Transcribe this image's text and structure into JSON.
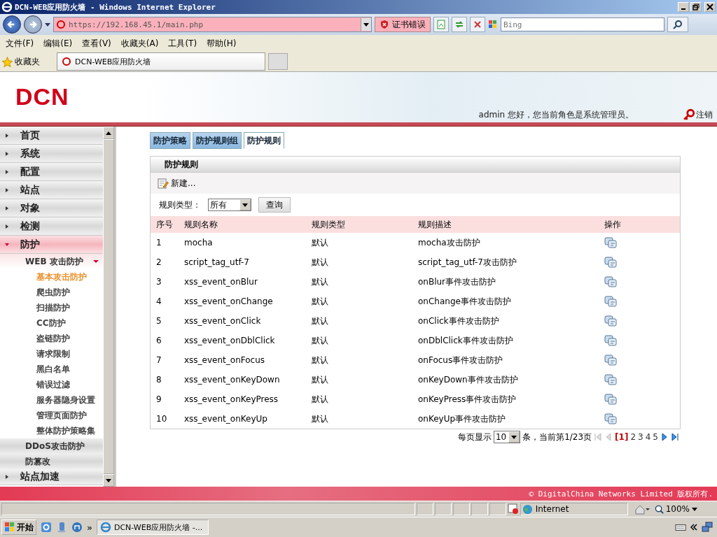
{
  "browser": {
    "title": "DCN-WEB应用防火墙 - Windows Internet Explorer",
    "address": "https://192.168.45.1/main.php",
    "cert_error": "证书错误",
    "search_placeholder": "Bing",
    "menus": [
      "文件(F)",
      "编辑(E)",
      "查看(V)",
      "收藏夹(A)",
      "工具(T)",
      "帮助(H)"
    ],
    "favorites": "收藏夹",
    "tab": "DCN-WEB应用防火墙"
  },
  "header": {
    "logo": "DCN",
    "greeting": "admin 您好，您当前角色是系统管理员。",
    "logout": "注销"
  },
  "sidebar": {
    "items": [
      {
        "label": "首页",
        "expanded": false
      },
      {
        "label": "系统",
        "expanded": false
      },
      {
        "label": "配置",
        "expanded": false
      },
      {
        "label": "站点",
        "expanded": false
      },
      {
        "label": "对象",
        "expanded": false
      },
      {
        "label": "检测",
        "expanded": false
      },
      {
        "label": "防护",
        "expanded": true,
        "children": [
          {
            "label": "WEB 攻击防护",
            "expanded": true,
            "children": [
              {
                "label": "基本攻击防护",
                "selected": true
              },
              {
                "label": "爬虫防护",
                "selected": false
              },
              {
                "label": "扫描防护",
                "selected": false
              },
              {
                "label": "CC防护",
                "selected": false
              },
              {
                "label": "盗链防护",
                "selected": false
              },
              {
                "label": "请求限制",
                "selected": false
              },
              {
                "label": "黑白名单",
                "selected": false
              },
              {
                "label": "错误过滤",
                "selected": false
              },
              {
                "label": "服务器隐身设置",
                "selected": false
              },
              {
                "label": "管理页面防护",
                "selected": false
              },
              {
                "label": "整体防护策略集",
                "selected": false
              }
            ]
          },
          {
            "label": "DDoS攻击防护"
          },
          {
            "label": "防篡改"
          }
        ]
      },
      {
        "label": "站点加速",
        "expanded": false
      }
    ]
  },
  "tabs": [
    {
      "label": "防护策略",
      "selected": false
    },
    {
      "label": "防护规则组",
      "selected": false
    },
    {
      "label": "防护规则",
      "selected": true
    }
  ],
  "panel": {
    "title": "防护规则",
    "new_button": "新建...",
    "filter_label": "规则类型：",
    "filter_value": "所有",
    "query_button": "查询"
  },
  "table": {
    "columns": [
      "序号",
      "规则名称",
      "规则类型",
      "规则描述",
      "操作"
    ],
    "rows": [
      [
        "1",
        "mocha",
        "默认",
        "mocha攻击防护"
      ],
      [
        "2",
        "script_tag_utf-7",
        "默认",
        "script_tag_utf-7攻击防护"
      ],
      [
        "3",
        "xss_event_onBlur",
        "默认",
        "onBlur事件攻击防护"
      ],
      [
        "4",
        "xss_event_onChange",
        "默认",
        "onChange事件攻击防护"
      ],
      [
        "5",
        "xss_event_onClick",
        "默认",
        "onClick事件攻击防护"
      ],
      [
        "6",
        "xss_event_onDblClick",
        "默认",
        "onDblClick事件攻击防护"
      ],
      [
        "7",
        "xss_event_onFocus",
        "默认",
        "onFocus事件攻击防护"
      ],
      [
        "8",
        "xss_event_onKeyDown",
        "默认",
        "onKeyDown事件攻击防护"
      ],
      [
        "9",
        "xss_event_onKeyPress",
        "默认",
        "onKeyPress事件攻击防护"
      ],
      [
        "10",
        "xss_event_onKeyUp",
        "默认",
        "onKeyUp事件攻击防护"
      ]
    ]
  },
  "pagination": {
    "per_page_label": "每页显示",
    "per_page": "10",
    "status": "条，当前第1/23页",
    "pages": [
      {
        "label": "[1]",
        "selected": true
      },
      {
        "label": "2",
        "selected": false
      },
      {
        "label": "3",
        "selected": false
      },
      {
        "label": "4",
        "selected": false
      },
      {
        "label": "5",
        "selected": false
      }
    ]
  },
  "footer": "© DigitalChina Networks Limited 版权所有.",
  "status_bar": {
    "zone": "Internet",
    "zoom": "100%"
  },
  "taskbar": {
    "start": "开始",
    "more": "»",
    "task": "DCN-WEB应用防火墙 -..."
  }
}
